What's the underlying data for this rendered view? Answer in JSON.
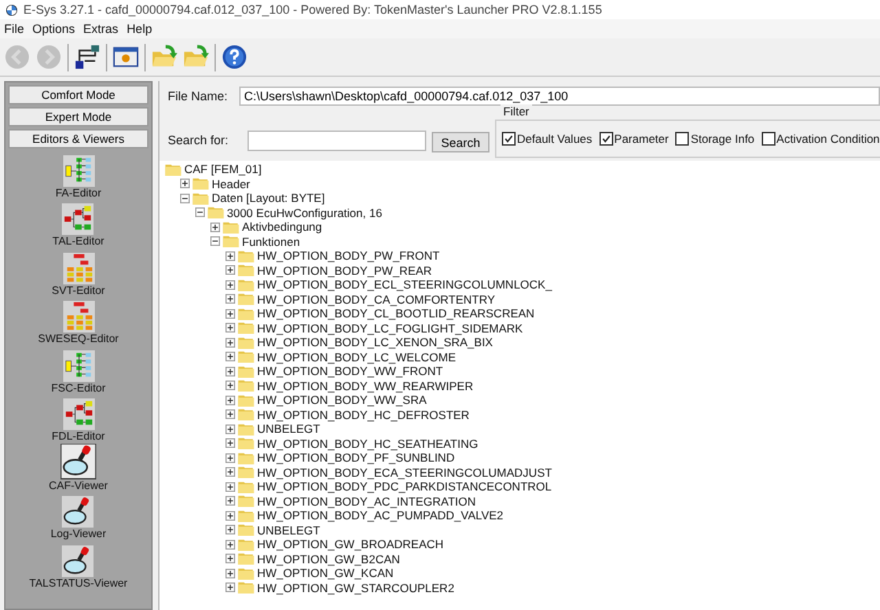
{
  "window": {
    "title": "E-Sys 3.27.1 - cafd_00000794.caf.012_037_100  - Powered By: TokenMaster's Launcher PRO V2.8.1.155"
  },
  "menu": [
    "File",
    "Options",
    "Extras",
    "Help"
  ],
  "toolbar": [
    {
      "kind": "back",
      "disabled": true
    },
    {
      "kind": "forward",
      "disabled": true
    },
    {
      "kind": "network",
      "disabled": false
    },
    {
      "kind": "window",
      "disabled": false
    },
    {
      "kind": "open",
      "disabled": false
    },
    {
      "kind": "folder",
      "disabled": false
    },
    {
      "kind": "help",
      "disabled": false
    }
  ],
  "sidebar": {
    "modes": [
      "Comfort Mode",
      "Expert Mode",
      "Editors & Viewers"
    ],
    "items": [
      {
        "label": "FA-Editor",
        "kind": "tree",
        "selected": false
      },
      {
        "label": "TAL-Editor",
        "kind": "branch",
        "selected": false
      },
      {
        "label": "SVT-Editor",
        "kind": "org",
        "selected": false
      },
      {
        "label": "SWESEQ-Editor",
        "kind": "org",
        "selected": false
      },
      {
        "label": "FSC-Editor",
        "kind": "tree",
        "selected": false
      },
      {
        "label": "FDL-Editor",
        "kind": "branch",
        "selected": false
      },
      {
        "label": "CAF-Viewer",
        "kind": "viewer",
        "selected": true
      },
      {
        "label": "Log-Viewer",
        "kind": "viewer",
        "selected": false
      },
      {
        "label": "TALSTATUS-Viewer",
        "kind": "viewer",
        "selected": false
      }
    ]
  },
  "file_name": {
    "label": "File Name:",
    "value": "C:\\Users\\shawn\\Desktop\\cafd_00000794.caf.012_037_100"
  },
  "search": {
    "label": "Search for:",
    "button": "Search"
  },
  "filter": {
    "title": "Filter",
    "options": [
      {
        "label": "Default Values",
        "checked": true
      },
      {
        "label": "Parameter",
        "checked": true
      },
      {
        "label": "Storage Info",
        "checked": false
      },
      {
        "label": "Activation Condition",
        "checked": false
      }
    ]
  },
  "tree": [
    {
      "label": "CAF [FEM_01]",
      "children": [
        {
          "label": "Header",
          "expanded": false
        },
        {
          "label": "Daten [Layout: BYTE]",
          "expanded": true,
          "children": [
            {
              "label": "3000 EcuHwConfiguration, 16",
              "expanded": true,
              "children": [
                {
                  "label": "Aktivbedingung",
                  "expanded": false
                },
                {
                  "label": "Funktionen",
                  "expanded": true,
                  "children": [
                    {
                      "label": "HW_OPTION_BODY_PW_FRONT",
                      "expanded": false
                    },
                    {
                      "label": "HW_OPTION_BODY_PW_REAR",
                      "expanded": false
                    },
                    {
                      "label": "HW_OPTION_BODY_ECL_STEERINGCOLUMNLOCK_",
                      "expanded": false
                    },
                    {
                      "label": "HW_OPTION_BODY_CA_COMFORTENTRY",
                      "expanded": false
                    },
                    {
                      "label": "HW_OPTION_BODY_CL_BOOTLID_REARSCREAN",
                      "expanded": false
                    },
                    {
                      "label": "HW_OPTION_BODY_LC_FOGLIGHT_SIDEMARK",
                      "expanded": false
                    },
                    {
                      "label": "HW_OPTION_BODY_LC_XENON_SRA_BIX",
                      "expanded": false
                    },
                    {
                      "label": "HW_OPTION_BODY_LC_WELCOME",
                      "expanded": false
                    },
                    {
                      "label": "HW_OPTION_BODY_WW_FRONT",
                      "expanded": false
                    },
                    {
                      "label": "HW_OPTION_BODY_WW_REARWIPER",
                      "expanded": false
                    },
                    {
                      "label": "HW_OPTION_BODY_WW_SRA",
                      "expanded": false
                    },
                    {
                      "label": "HW_OPTION_BODY_HC_DEFROSTER",
                      "expanded": false
                    },
                    {
                      "label": "UNBELEGT",
                      "expanded": false
                    },
                    {
                      "label": "HW_OPTION_BODY_HC_SEATHEATING",
                      "expanded": false
                    },
                    {
                      "label": "HW_OPTION_BODY_PF_SUNBLIND",
                      "expanded": false
                    },
                    {
                      "label": "HW_OPTION_BODY_ECA_STEERINGCOLUMADJUST",
                      "expanded": false
                    },
                    {
                      "label": "HW_OPTION_BODY_PDC_PARKDISTANCECONTROL",
                      "expanded": false
                    },
                    {
                      "label": "HW_OPTION_BODY_AC_INTEGRATION",
                      "expanded": false
                    },
                    {
                      "label": "HW_OPTION_BODY_AC_PUMPADD_VALVE2",
                      "expanded": false
                    },
                    {
                      "label": "UNBELEGT",
                      "expanded": false
                    },
                    {
                      "label": "HW_OPTION_GW_BROADREACH",
                      "expanded": false
                    },
                    {
                      "label": "HW_OPTION_GW_B2CAN",
                      "expanded": false
                    },
                    {
                      "label": "HW_OPTION_GW_KCAN",
                      "expanded": false
                    },
                    {
                      "label": "HW_OPTION_GW_STARCOUPLER2",
                      "expanded": false
                    }
                  ]
                }
              ]
            }
          ]
        }
      ]
    }
  ]
}
